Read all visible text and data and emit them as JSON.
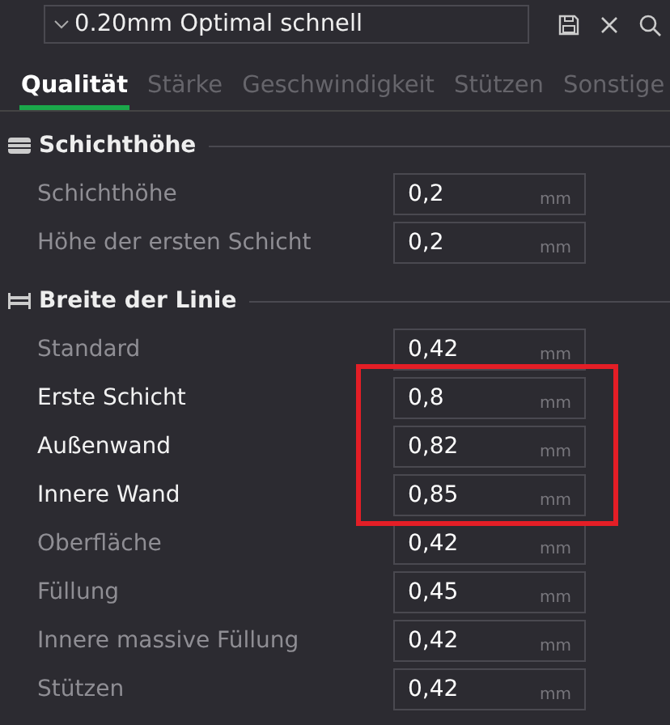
{
  "preset": {
    "value": "0.20mm Optimal schnell"
  },
  "tabs": [
    {
      "label": "Qualität",
      "selected": true
    },
    {
      "label": "Stärke",
      "selected": false
    },
    {
      "label": "Geschwindigkeit",
      "selected": false
    },
    {
      "label": "Stützen",
      "selected": false
    },
    {
      "label": "Sonstige",
      "selected": false
    }
  ],
  "sections": [
    {
      "title": "Schichthöhe",
      "kind": "layers",
      "rows": [
        {
          "label": "Schichthöhe",
          "value": "0,2",
          "unit": "mm",
          "modified": false,
          "highlighted": false
        },
        {
          "label": "Höhe der ersten Schicht",
          "value": "0,2",
          "unit": "mm",
          "modified": false,
          "highlighted": false
        }
      ]
    },
    {
      "title": "Breite der Linie",
      "kind": "width",
      "rows": [
        {
          "label": "Standard",
          "value": "0,42",
          "unit": "mm",
          "modified": false,
          "highlighted": false
        },
        {
          "label": "Erste Schicht",
          "value": "0,8",
          "unit": "mm",
          "modified": true,
          "highlighted": true
        },
        {
          "label": "Außenwand",
          "value": "0,82",
          "unit": "mm",
          "modified": true,
          "highlighted": true
        },
        {
          "label": "Innere Wand",
          "value": "0,85",
          "unit": "mm",
          "modified": true,
          "highlighted": true
        },
        {
          "label": "Oberfläche",
          "value": "0,42",
          "unit": "mm",
          "modified": false,
          "highlighted": false
        },
        {
          "label": "Füllung",
          "value": "0,45",
          "unit": "mm",
          "modified": false,
          "highlighted": false
        },
        {
          "label": "Innere massive Füllung",
          "value": "0,42",
          "unit": "mm",
          "modified": false,
          "highlighted": false
        },
        {
          "label": "Stützen",
          "value": "0,42",
          "unit": "mm",
          "modified": false,
          "highlighted": false
        }
      ]
    }
  ]
}
